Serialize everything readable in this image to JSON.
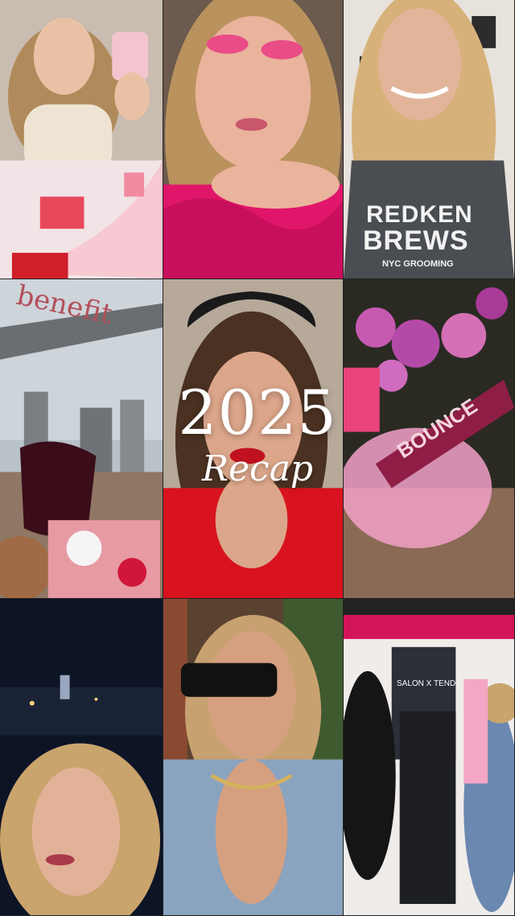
{
  "overlay": {
    "year": "2025",
    "subtitle": "Recap"
  },
  "signage": {
    "shirt_line1": "REDKEN",
    "shirt_line2": "BREWS",
    "shirt_line3": "NYC GROOMING",
    "brand_sign": "benefit",
    "product_box": "BOUNCE",
    "store_sign": "SALON X TEND"
  },
  "colors": {
    "accent_pink": "#e0407a",
    "deep_pink": "#d4145a",
    "red": "#d01f2a"
  }
}
